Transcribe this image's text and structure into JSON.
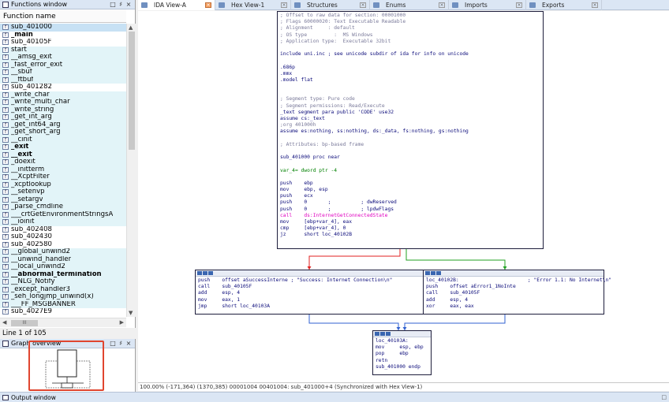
{
  "functions_window": {
    "title": "Functions window",
    "buttons": [
      "□",
      "♯",
      "×"
    ],
    "column_header": "Function name",
    "items": [
      {
        "name": "sub_401000",
        "style": "sel"
      },
      {
        "name": "_main",
        "style": "bold"
      },
      {
        "name": "sub_40105F",
        "style": ""
      },
      {
        "name": "start",
        "style": "lib"
      },
      {
        "name": "__amsg_exit",
        "style": "lib"
      },
      {
        "name": "_fast_error_exit",
        "style": "lib"
      },
      {
        "name": "__sbuf",
        "style": "lib"
      },
      {
        "name": "__ftbuf",
        "style": "lib"
      },
      {
        "name": "sub_401282",
        "style": ""
      },
      {
        "name": "_write_char",
        "style": "lib"
      },
      {
        "name": "_write_multi_char",
        "style": "lib"
      },
      {
        "name": "_write_string",
        "style": "lib"
      },
      {
        "name": "_get_int_arg",
        "style": "lib"
      },
      {
        "name": "_get_int64_arg",
        "style": "lib"
      },
      {
        "name": "_get_short_arg",
        "style": "lib"
      },
      {
        "name": "__cinit",
        "style": "lib"
      },
      {
        "name": "_exit",
        "style": "lib bold"
      },
      {
        "name": "__exit",
        "style": "lib bold"
      },
      {
        "name": "_doexit",
        "style": "lib"
      },
      {
        "name": "__initterm",
        "style": "lib"
      },
      {
        "name": "__XcptFilter",
        "style": "lib"
      },
      {
        "name": "_xcptlookup",
        "style": "lib"
      },
      {
        "name": "__setenvp",
        "style": "lib"
      },
      {
        "name": "__setargv",
        "style": "lib"
      },
      {
        "name": "_parse_cmdline",
        "style": "lib"
      },
      {
        "name": "___crtGetEnvironmentStringsA",
        "style": "lib"
      },
      {
        "name": "__ioinit",
        "style": "lib"
      },
      {
        "name": "sub_402408",
        "style": ""
      },
      {
        "name": "sub_402430",
        "style": ""
      },
      {
        "name": "sub_402580",
        "style": ""
      },
      {
        "name": "__global_unwind2",
        "style": "lib"
      },
      {
        "name": "__unwind_handler",
        "style": "lib"
      },
      {
        "name": "__local_unwind2",
        "style": "lib"
      },
      {
        "name": "__abnormal_termination",
        "style": "lib bold"
      },
      {
        "name": "__NLG_Notify",
        "style": "lib"
      },
      {
        "name": "_except_handler3",
        "style": "lib"
      },
      {
        "name": "_seh_longjmp_unwind(x)",
        "style": "lib"
      },
      {
        "name": "___FF_MSGBANNER",
        "style": "lib"
      },
      {
        "name": "sub_4027E9",
        "style": ""
      }
    ],
    "hscroll_thumb": "III",
    "status": "Line 1 of 105"
  },
  "graph_overview": {
    "title": "Graph overview",
    "buttons": [
      "□",
      "♯",
      "×"
    ]
  },
  "tabs": [
    {
      "label": "IDA View-A",
      "active": true
    },
    {
      "label": "Hex View-1",
      "active": false
    },
    {
      "label": "Structures",
      "active": false
    },
    {
      "label": "Enums",
      "active": false
    },
    {
      "label": "Imports",
      "active": false
    },
    {
      "label": "Exports",
      "active": false
    }
  ],
  "ida_view": {
    "main_block": [
      [
        "; Offset to raw data for section: 00001000",
        "gray"
      ],
      [
        "; Flags 60000020: Text Executable Readable",
        "gray"
      ],
      [
        "; Alignment     : default",
        "gray"
      ],
      [
        "; OS type         :  MS Windows",
        "gray"
      ],
      [
        "; Application type:  Executable 32bit",
        "gray"
      ],
      [
        "",
        ""
      ],
      [
        "include uni.inc ; see unicode subdir of ida for info on unicode",
        "navy"
      ],
      [
        "",
        ""
      ],
      [
        ".686p",
        "navy"
      ],
      [
        ".mmx",
        "navy"
      ],
      [
        ".model flat",
        "navy"
      ],
      [
        "",
        ""
      ],
      [
        "",
        ""
      ],
      [
        "; Segment type: Pure code",
        "gray"
      ],
      [
        "; Segment permissions: Read/Execute",
        "gray"
      ],
      [
        "_text segment para public 'CODE' use32",
        "navy"
      ],
      [
        "assume cs:_text",
        "navy"
      ],
      [
        ";org 401000h",
        "gray"
      ],
      [
        "assume es:nothing, ss:nothing, ds:_data, fs:nothing, gs:nothing",
        "navy"
      ],
      [
        "",
        ""
      ],
      [
        "; Attributes: bp-based frame",
        "gray"
      ],
      [
        "",
        ""
      ],
      [
        "sub_401000 proc near",
        "navy"
      ],
      [
        "",
        ""
      ],
      [
        "var_4= dword ptr -4",
        "green"
      ],
      [
        "",
        ""
      ],
      [
        "push    ebp",
        "navy"
      ],
      [
        "mov     ebp, esp",
        "navy"
      ],
      [
        "push    ecx",
        "navy"
      ],
      [
        "push    0       ;          ; dwReserved",
        "navy"
      ],
      [
        "push    0       ;          ; lpdwFlags",
        "navy"
      ],
      [
        "call    ds:InternetGetConnectedState",
        "pink"
      ],
      [
        "mov     [ebp+var_4], eax",
        "navy"
      ],
      [
        "cmp     [ebp+var_4], 0",
        "navy"
      ],
      [
        "jz      short loc_40102B",
        "navy"
      ]
    ],
    "left_block": [
      [
        "push    offset aSuccessInterne ; \"Success: Internet Connection\\n\"",
        "navy"
      ],
      [
        "call    sub_40105F",
        "navy"
      ],
      [
        "add     esp, 4",
        "navy"
      ],
      [
        "mov     eax, 1",
        "navy"
      ],
      [
        "jmp     short loc_40103A",
        "navy"
      ]
    ],
    "right_block": [
      [
        "loc_40102B:                       ; \"Error 1.1: No Internet\\n\"",
        "navy"
      ],
      [
        "push    offset aError1_1NoInte",
        "navy"
      ],
      [
        "call    sub_40105F",
        "navy"
      ],
      [
        "add     esp, 4",
        "navy"
      ],
      [
        "xor     eax, eax",
        "navy"
      ]
    ],
    "bottom_block": [
      [
        "loc_40103A:",
        "navy"
      ],
      [
        "mov     esp, ebp",
        "navy"
      ],
      [
        "pop     ebp",
        "navy"
      ],
      [
        "retn",
        "navy"
      ],
      [
        "sub_401000 endp",
        "navy"
      ]
    ],
    "colors": {
      "edge_true": "#20a020",
      "edge_false": "#e02020",
      "edge_jump": "#3060d0"
    }
  },
  "ida_status": "100.00% (-171,364) (1370,385) 00001004 00401004: sub_401000+4 (Synchronized with Hex View-1)",
  "output_window": {
    "title": "Output window",
    "button": "□"
  }
}
